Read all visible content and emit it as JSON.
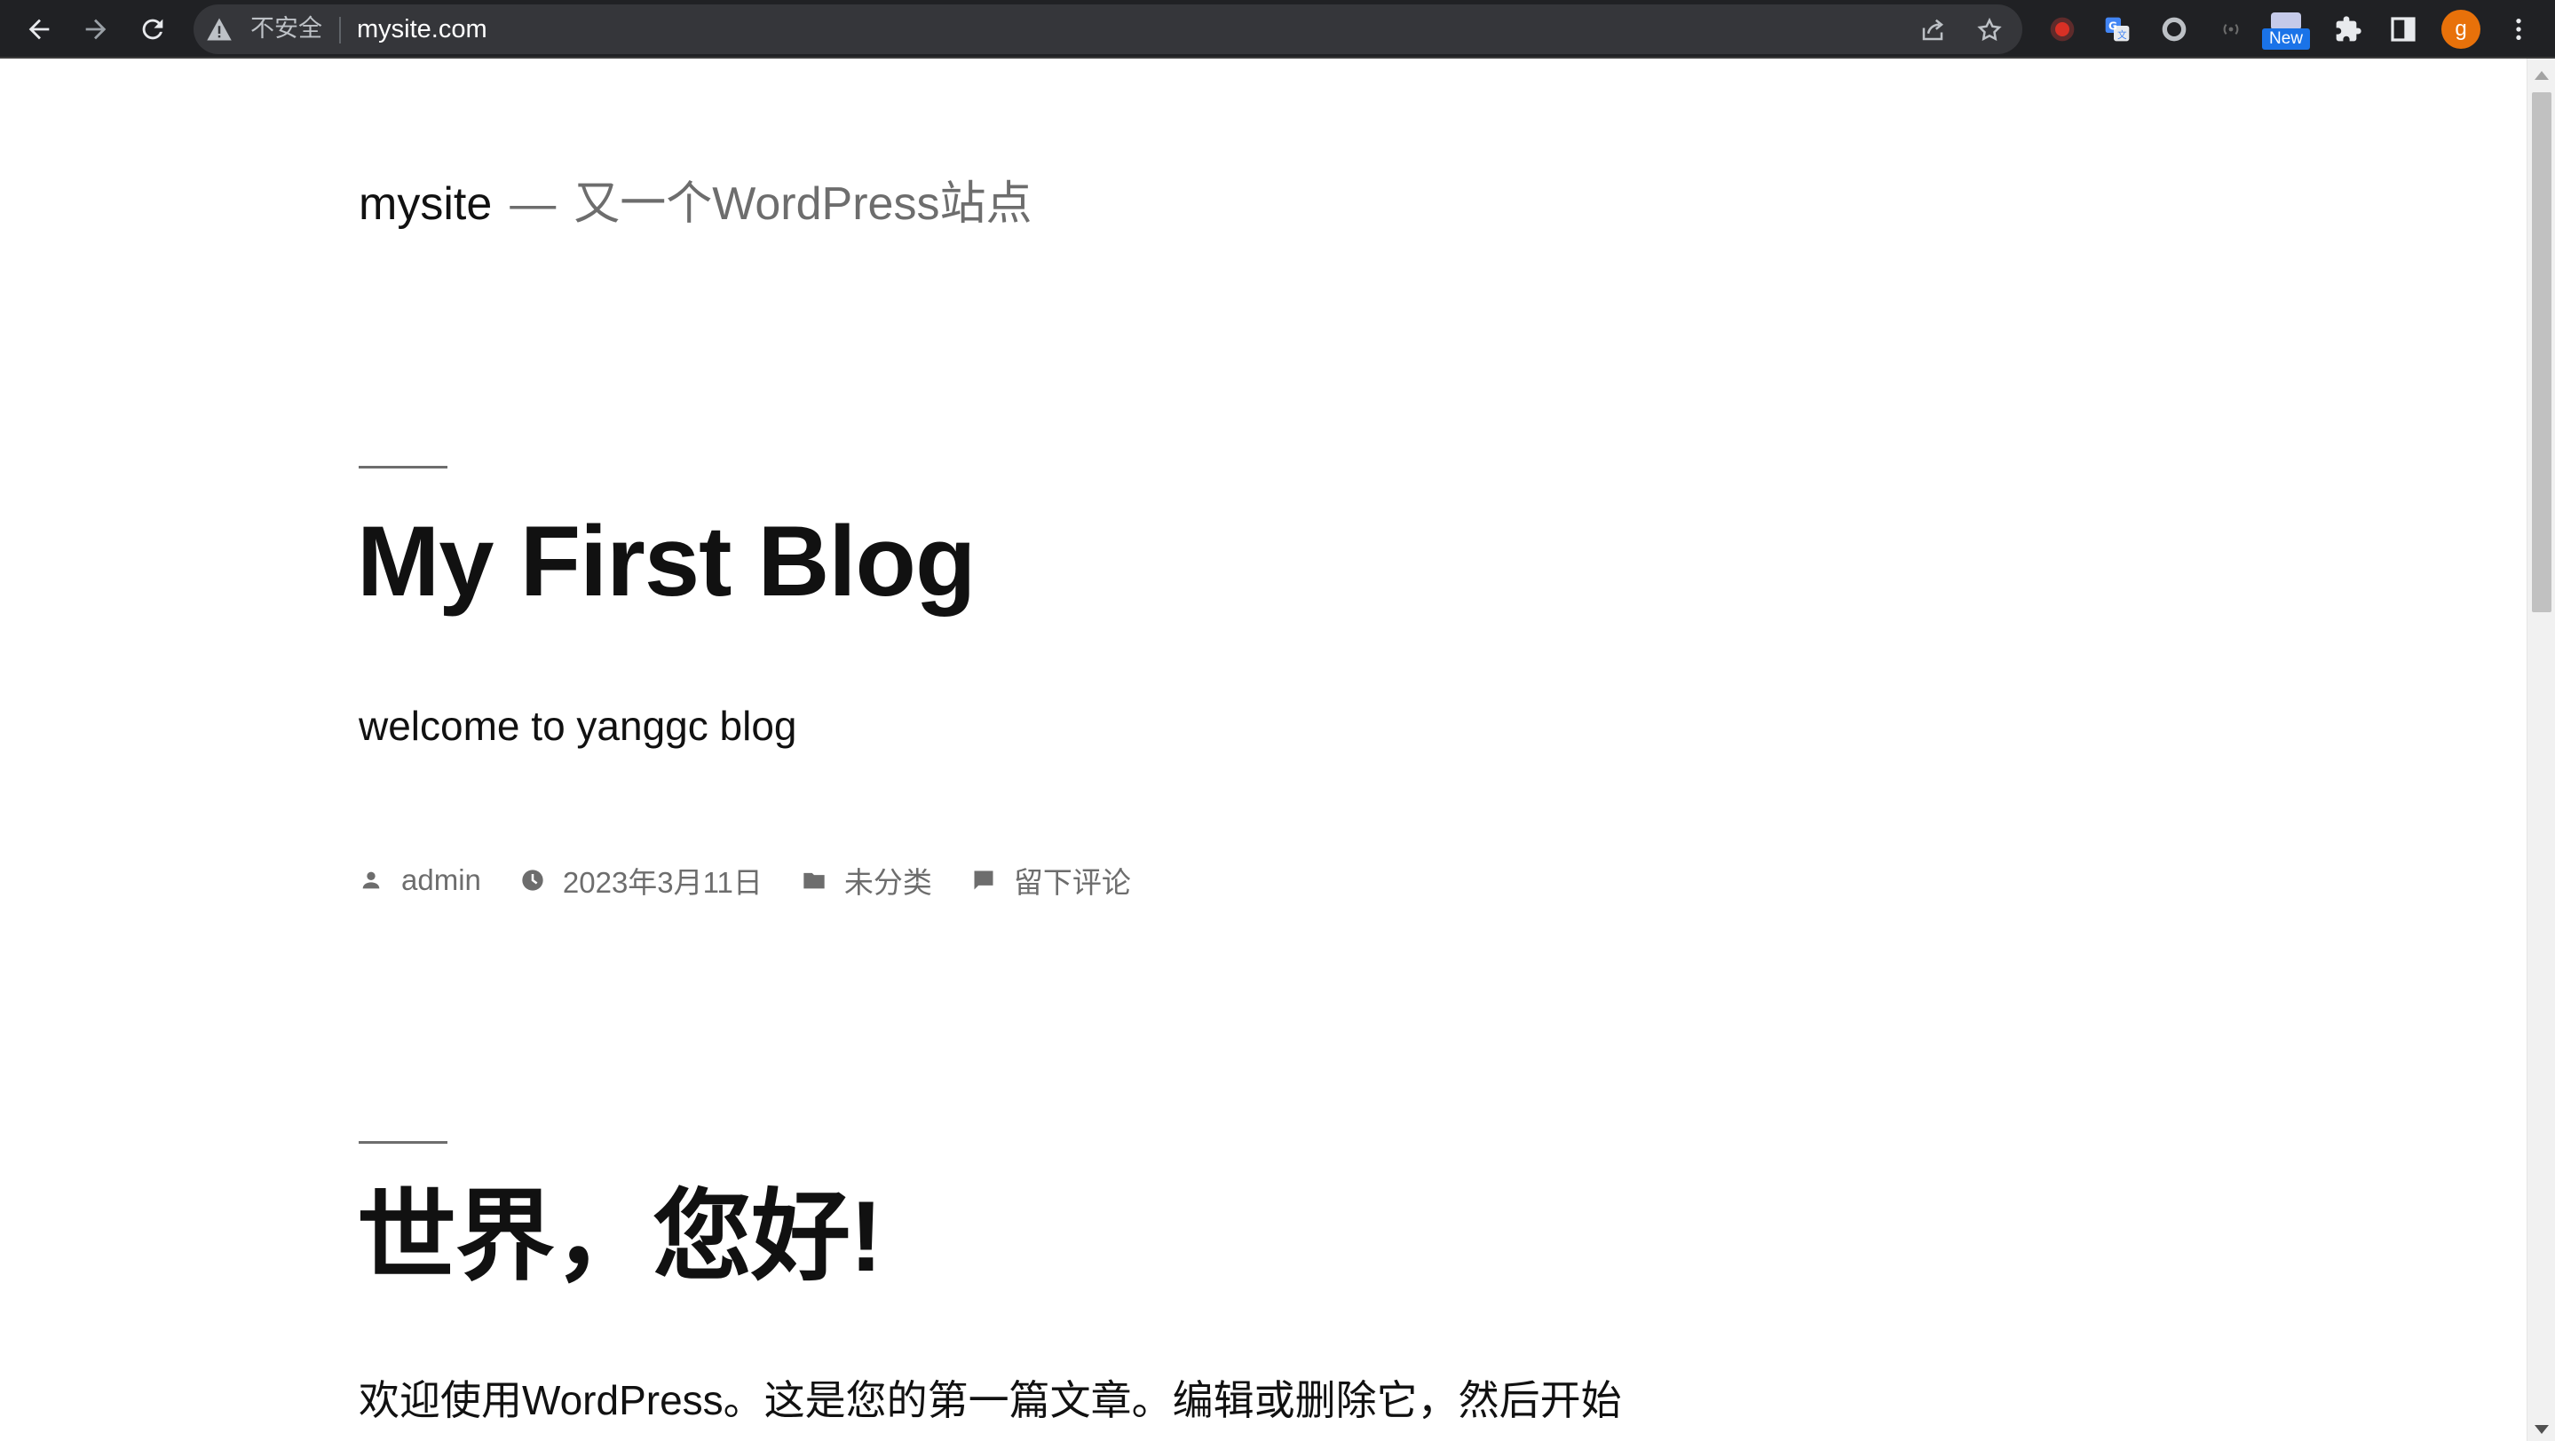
{
  "browser": {
    "security_label": "不安全",
    "url": "mysite.com",
    "profile_initial": "g",
    "new_badge": "New",
    "icons": {
      "back": "arrow-left-icon",
      "forward": "arrow-right-icon",
      "reload": "reload-icon",
      "security": "warning-triangle-icon",
      "share": "share-icon",
      "bookmark": "star-icon",
      "extensions": "puzzle-icon",
      "side_panel": "side-panel-icon",
      "menu": "kebab-menu-icon"
    },
    "colors": {
      "toolbar_bg": "#202124",
      "omnibox_bg": "#35363a",
      "avatar": "#e8710a",
      "badge": "#1a73e8",
      "record_ext": "#d93025"
    }
  },
  "site": {
    "title": "mysite",
    "separator": "—",
    "description": "又一个WordPress站点"
  },
  "posts": [
    {
      "title": "My First Blog",
      "excerpt": "welcome to yanggc blog",
      "meta": {
        "author": "admin",
        "date": "2023年3月11日",
        "category": "未分类",
        "comments": "留下评论"
      }
    },
    {
      "title": "世界，您好!",
      "excerpt": "欢迎使用WordPress。这是您的第一篇文章。编辑或删除它，然后开始"
    }
  ],
  "colors": {
    "text_primary": "#111111",
    "text_secondary": "#6d6d6d"
  }
}
